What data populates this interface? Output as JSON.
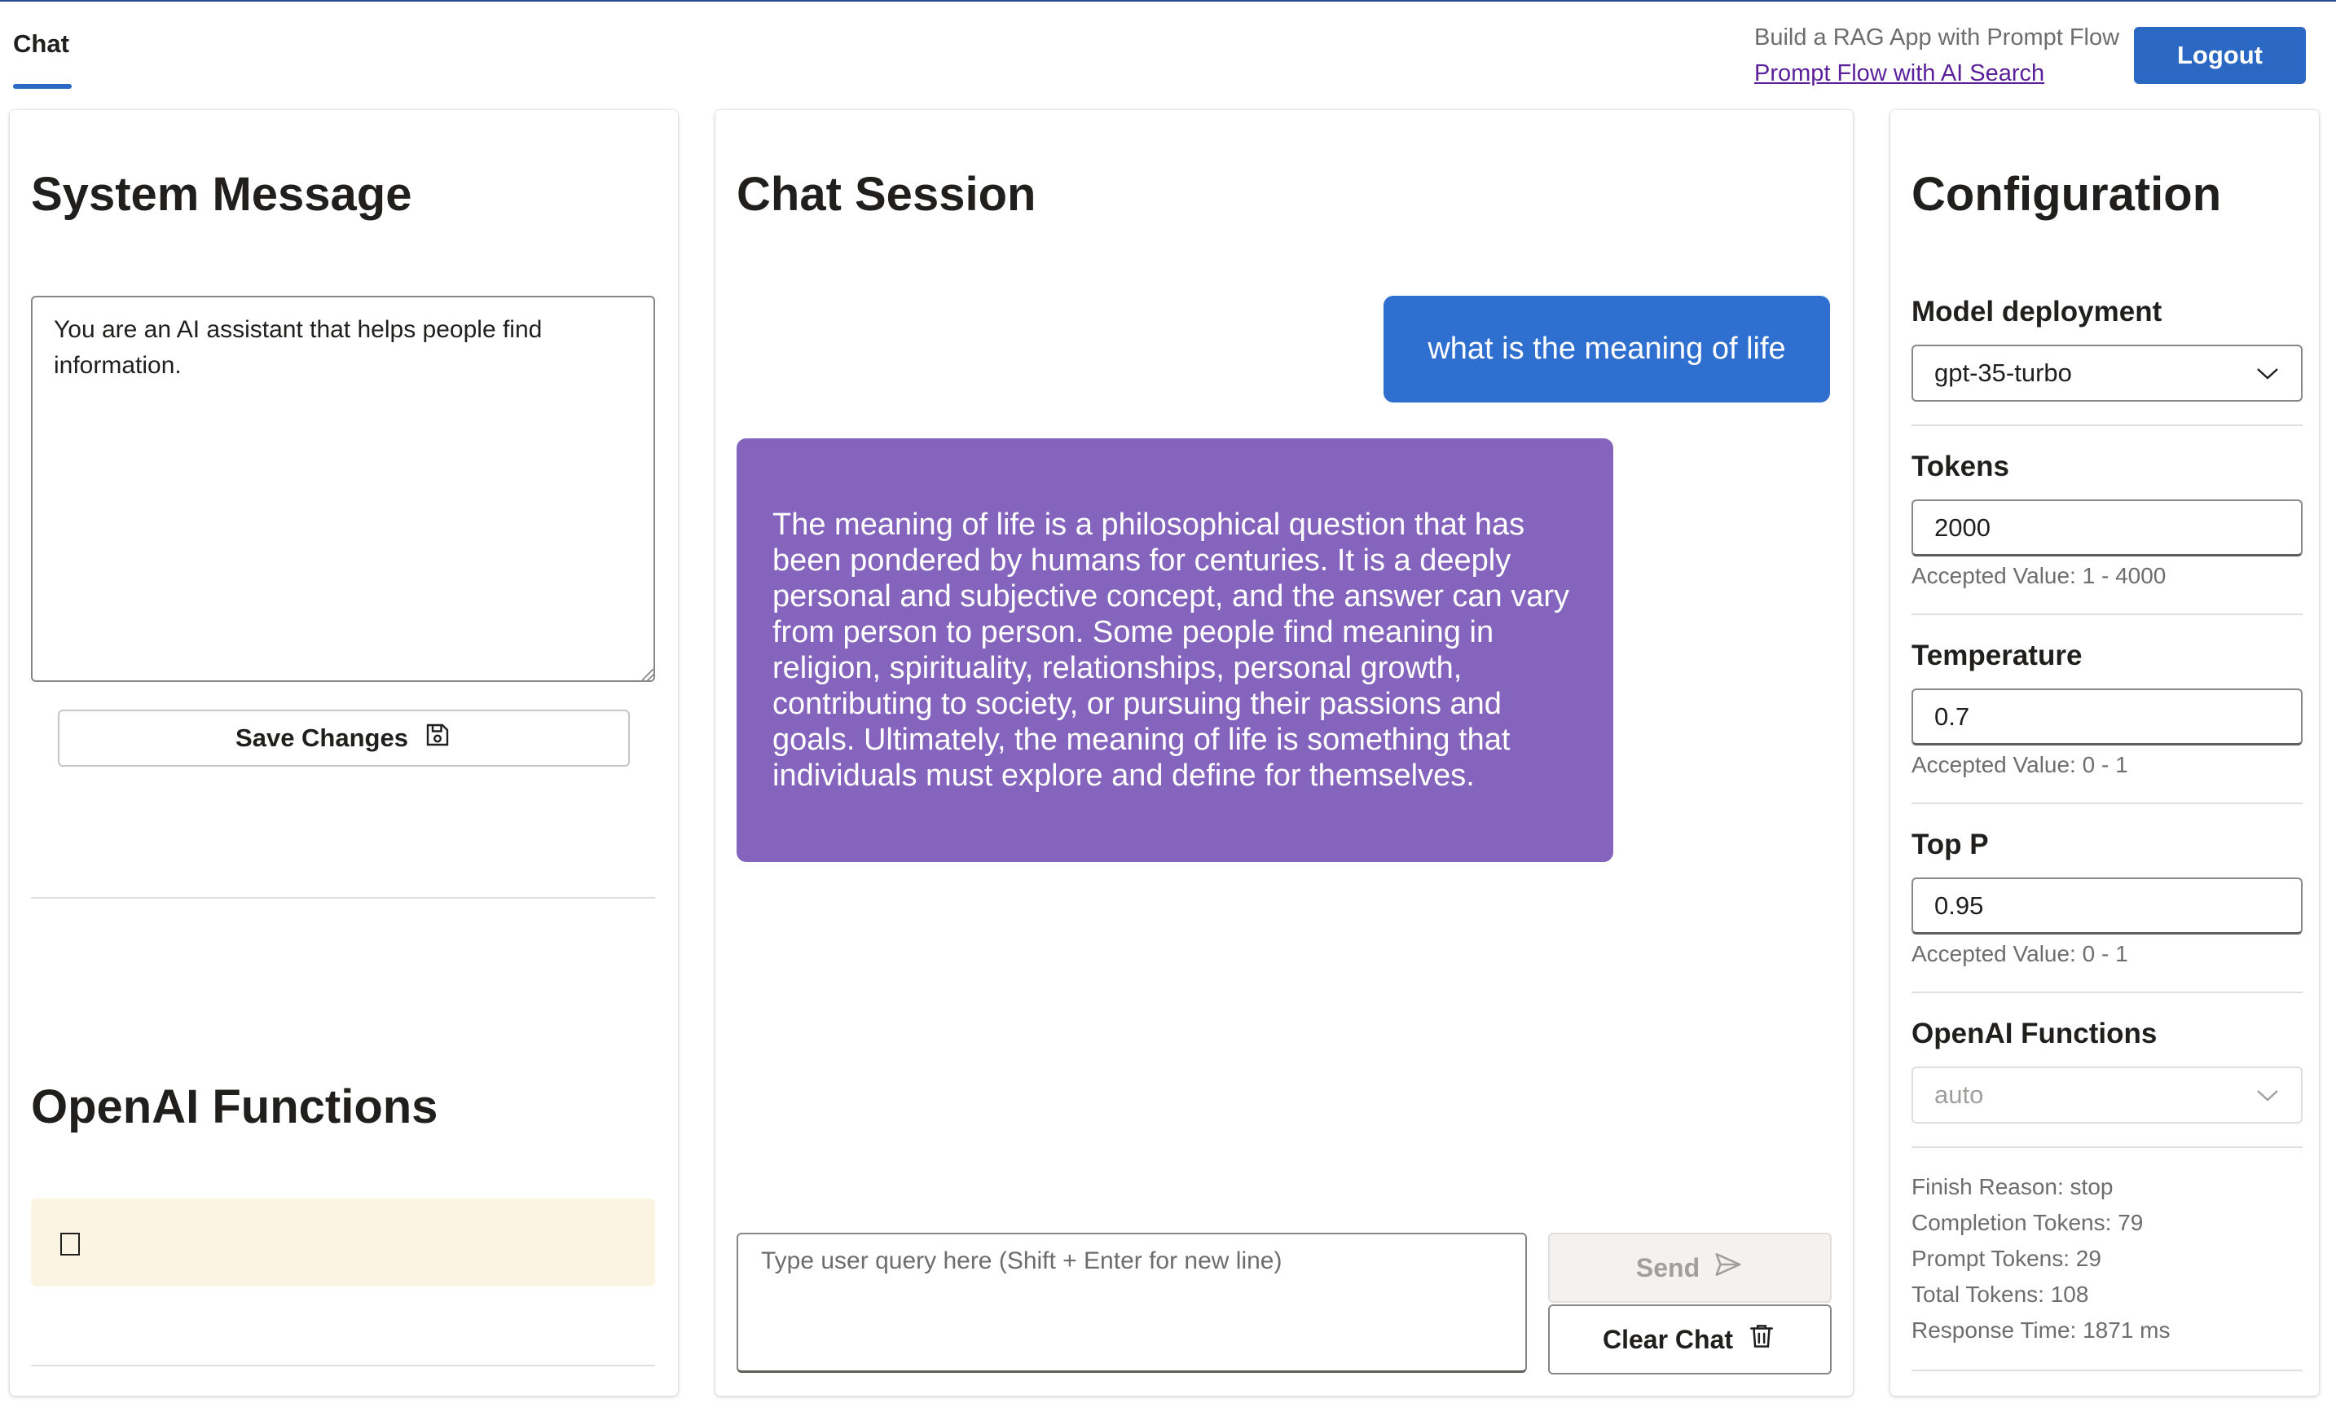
{
  "header": {
    "tab_label": "Chat",
    "tagline": "Build a RAG App with Prompt Flow",
    "link_text": "Prompt Flow with AI Search",
    "logout_label": "Logout"
  },
  "system_panel": {
    "title": "System Message",
    "message": "You are an AI assistant that helps people find information.",
    "save_label": "Save Changes",
    "functions_title": "OpenAI Functions",
    "functions_value": "[]"
  },
  "chat_panel": {
    "title": "Chat Session",
    "messages": [
      {
        "role": "user",
        "text": "what is the meaning of life"
      },
      {
        "role": "assistant",
        "text": "The meaning of life is a philosophical question that has been pondered by humans for centuries. It is a deeply personal and subjective concept, and the answer can vary from person to person. Some people find meaning in religion, spirituality, relationships, personal growth, contributing to society, or pursuing their passions and goals. Ultimately, the meaning of life is something that individuals must explore and define for themselves."
      }
    ],
    "query_placeholder": "Type user query here (Shift + Enter for new line)",
    "send_label": "Send",
    "clear_label": "Clear Chat"
  },
  "config_panel": {
    "title": "Configuration",
    "model_label": "Model deployment",
    "model_value": "gpt-35-turbo",
    "tokens_label": "Tokens",
    "tokens_value": "2000",
    "tokens_hint": "Accepted Value: 1 - 4000",
    "temperature_label": "Temperature",
    "temperature_value": "0.7",
    "temperature_hint": "Accepted Value: 0 - 1",
    "top_p_label": "Top P",
    "top_p_value": "0.95",
    "top_p_hint": "Accepted Value: 0 - 1",
    "functions_label": "OpenAI Functions",
    "functions_value": "auto",
    "stats": {
      "finish_reason": "Finish Reason: stop",
      "completion_tokens": "Completion Tokens: 79",
      "prompt_tokens": "Prompt Tokens: 29",
      "total_tokens": "Total Tokens: 108",
      "response_time": "Response Time: 1871 ms"
    }
  },
  "colors": {
    "accent": "#2b68c4",
    "user_bubble": "#2f6fcf",
    "assistant_bubble": "#8464bd",
    "functions_box": "#fbf4e2",
    "link": "#5b1f9a"
  },
  "icons": {
    "save": "save-icon",
    "send": "send-icon",
    "clear": "trash-icon",
    "dropdown": "chevron-down-icon"
  }
}
